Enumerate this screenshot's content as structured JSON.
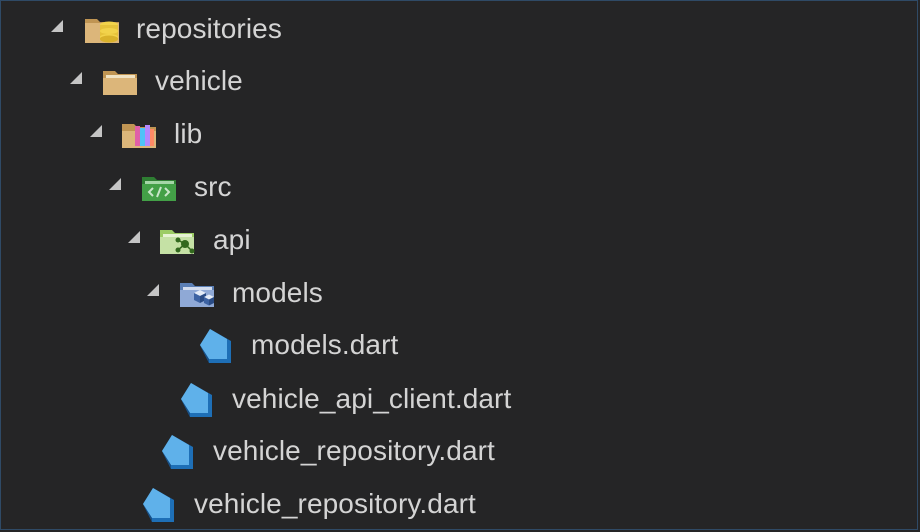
{
  "explorer": {
    "items": [
      {
        "label": "repositories",
        "kind": "folder",
        "icon": "database-folder-icon",
        "expanded": true,
        "depth": 0
      },
      {
        "label": "vehicle",
        "kind": "folder",
        "icon": "folder-open-icon",
        "expanded": true,
        "depth": 1
      },
      {
        "label": "lib",
        "kind": "folder",
        "icon": "library-folder-icon",
        "expanded": true,
        "depth": 2
      },
      {
        "label": "src",
        "kind": "folder",
        "icon": "source-folder-icon",
        "expanded": true,
        "depth": 3
      },
      {
        "label": "api",
        "kind": "folder",
        "icon": "api-folder-icon",
        "expanded": true,
        "depth": 4
      },
      {
        "label": "models",
        "kind": "folder",
        "icon": "models-folder-icon",
        "expanded": true,
        "depth": 5
      },
      {
        "label": "models.dart",
        "kind": "file",
        "icon": "dart-file-icon",
        "depth": 6
      },
      {
        "label": "vehicle_api_client.dart",
        "kind": "file",
        "icon": "dart-file-icon",
        "depth": 5
      },
      {
        "label": "vehicle_repository.dart",
        "kind": "file",
        "icon": "dart-file-icon",
        "depth": 4
      },
      {
        "label": "vehicle_repository.dart",
        "kind": "file",
        "icon": "dart-file-icon",
        "depth": 3
      }
    ]
  },
  "colors": {
    "background": "#252526",
    "text": "#d4d4d4",
    "twistie": "#c5c5c5",
    "folder": "#dcb67a",
    "dart_light": "#5fb1ea",
    "dart_dark": "#1e6fb6"
  }
}
